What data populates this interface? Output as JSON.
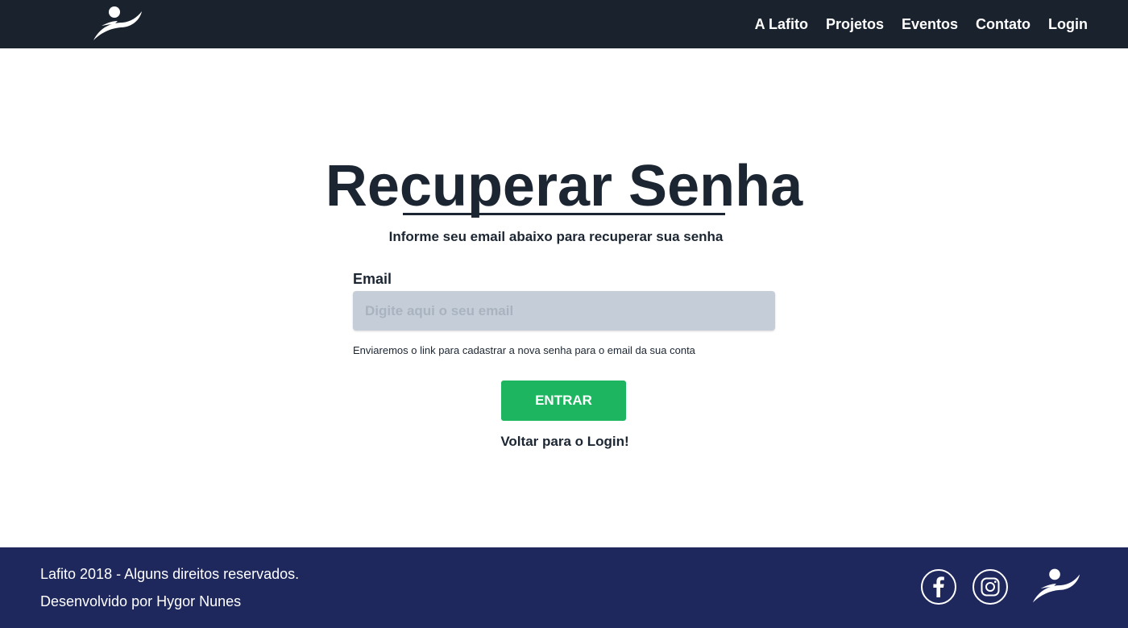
{
  "header": {
    "logo_icon": "lafito-runner-logo-icon",
    "nav": [
      {
        "label": "A Lafito"
      },
      {
        "label": "Projetos"
      },
      {
        "label": "Eventos"
      },
      {
        "label": "Contato"
      },
      {
        "label": "Login"
      }
    ]
  },
  "main": {
    "title": "Recuperar Senha",
    "subtitle": "Informe seu email abaixo para recuperar sua senha",
    "email_label": "Email",
    "email_value": "",
    "email_placeholder": "Digite aqui o seu email",
    "helper_text": "Enviaremos o link para cadastrar a nova senha para o email da sua conta",
    "submit_label": "ENTRAR",
    "back_link": "Voltar para o Login!"
  },
  "footer": {
    "copyright": "Lafito 2018 - Alguns direitos reservados.",
    "developer": "Desenvolvido por Hygor Nunes",
    "icons": [
      "facebook-icon",
      "instagram-icon",
      "lafito-runner-logo-icon"
    ]
  },
  "colors": {
    "header_bg": "#1a232d",
    "footer_bg": "#1e285c",
    "accent_green": "#1eb561",
    "input_bg": "#c5ced8",
    "text_dark": "#1c2632"
  }
}
